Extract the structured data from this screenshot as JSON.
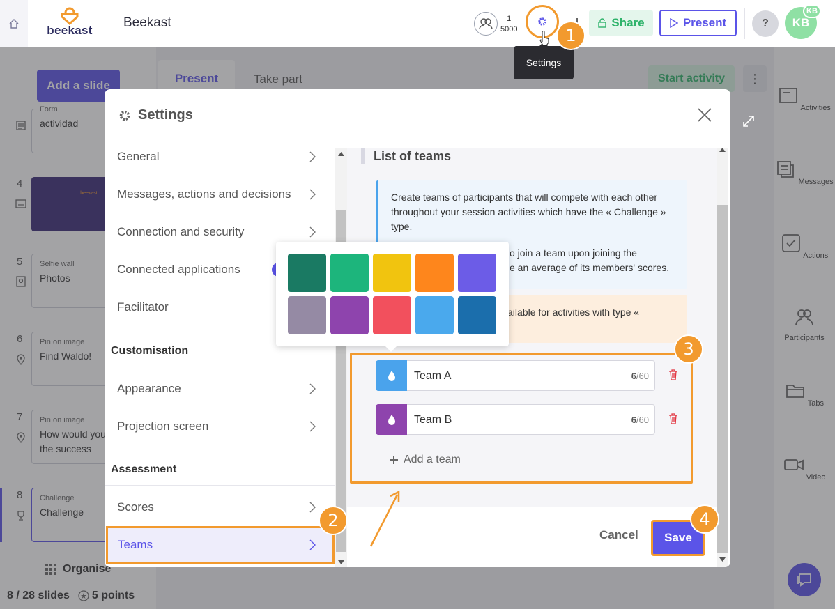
{
  "header": {
    "logo_text": "beekast",
    "presentation_title": "Beekast",
    "participants_current": "1",
    "participants_max": "5000",
    "share_label": "Share",
    "present_label": "Present",
    "help_label": "?",
    "avatar_initials": "KB",
    "avatar_badge": "KB",
    "settings_tooltip": "Settings"
  },
  "left_panel": {
    "add_slide_label": "Add a slide",
    "slides": [
      {
        "num": "",
        "type": "Form",
        "name": "actividad"
      },
      {
        "num": "4",
        "type": "",
        "name": ""
      },
      {
        "num": "5",
        "type": "Selfie wall",
        "name": "Photos"
      },
      {
        "num": "6",
        "type": "Pin on image",
        "name": "Find Waldo!"
      },
      {
        "num": "7",
        "type": "Pin on image",
        "name": "How would you rate the success"
      },
      {
        "num": "8",
        "type": "Challenge",
        "name": "Challenge"
      }
    ],
    "thumb_title": "beekast",
    "organise_label": "Organise",
    "slides_count": "8 / 28 slides",
    "points": "5 points"
  },
  "center": {
    "tab_present": "Present",
    "tab_take_part": "Take part",
    "start_activity": "Start activity"
  },
  "right_rail": {
    "items": [
      "Activities",
      "Messages",
      "Actions",
      "Participants",
      "Tabs",
      "Video"
    ]
  },
  "modal": {
    "title": "Settings",
    "nav": {
      "items": [
        "General",
        "Messages, actions and decisions",
        "Connection and security",
        "Connected applications",
        "Facilitator"
      ],
      "section_customisation": "Customisation",
      "customisation_items": [
        "Appearance",
        "Projection screen"
      ],
      "section_assessment": "Assessment",
      "assessment_items": [
        "Scores",
        "Teams"
      ]
    },
    "content": {
      "list_title": "List of teams",
      "info_p1": "Create teams of participants that will compete with each other throughout your session activities which have the « Challenge » type.",
      "info_p2_visible": "o join a team upon joining the",
      "info_p3_visible": "e an average of its members' scores.",
      "warn_visible": "ailable for activities with type «",
      "teams": [
        {
          "name": "Team A",
          "count": "6",
          "max": "/60",
          "color": "#4aa3ec"
        },
        {
          "name": "Team B",
          "count": "6",
          "max": "/60",
          "color": "#8e44ad"
        }
      ],
      "add_team_label": "Add a team"
    },
    "footer": {
      "cancel_label": "Cancel",
      "save_label": "Save"
    },
    "color_options": [
      "#1a7a63",
      "#1db57c",
      "#f1c40f",
      "#fe861c",
      "#6c5ce7",
      "#958aa4",
      "#8e44ad",
      "#f2505d",
      "#4aa9ed",
      "#1b6eac"
    ]
  },
  "steps": [
    "1",
    "2",
    "3",
    "4"
  ],
  "colors": {
    "accent": "#5b54e8",
    "highlight": "#f29a2e",
    "success": "#2fb36b"
  }
}
